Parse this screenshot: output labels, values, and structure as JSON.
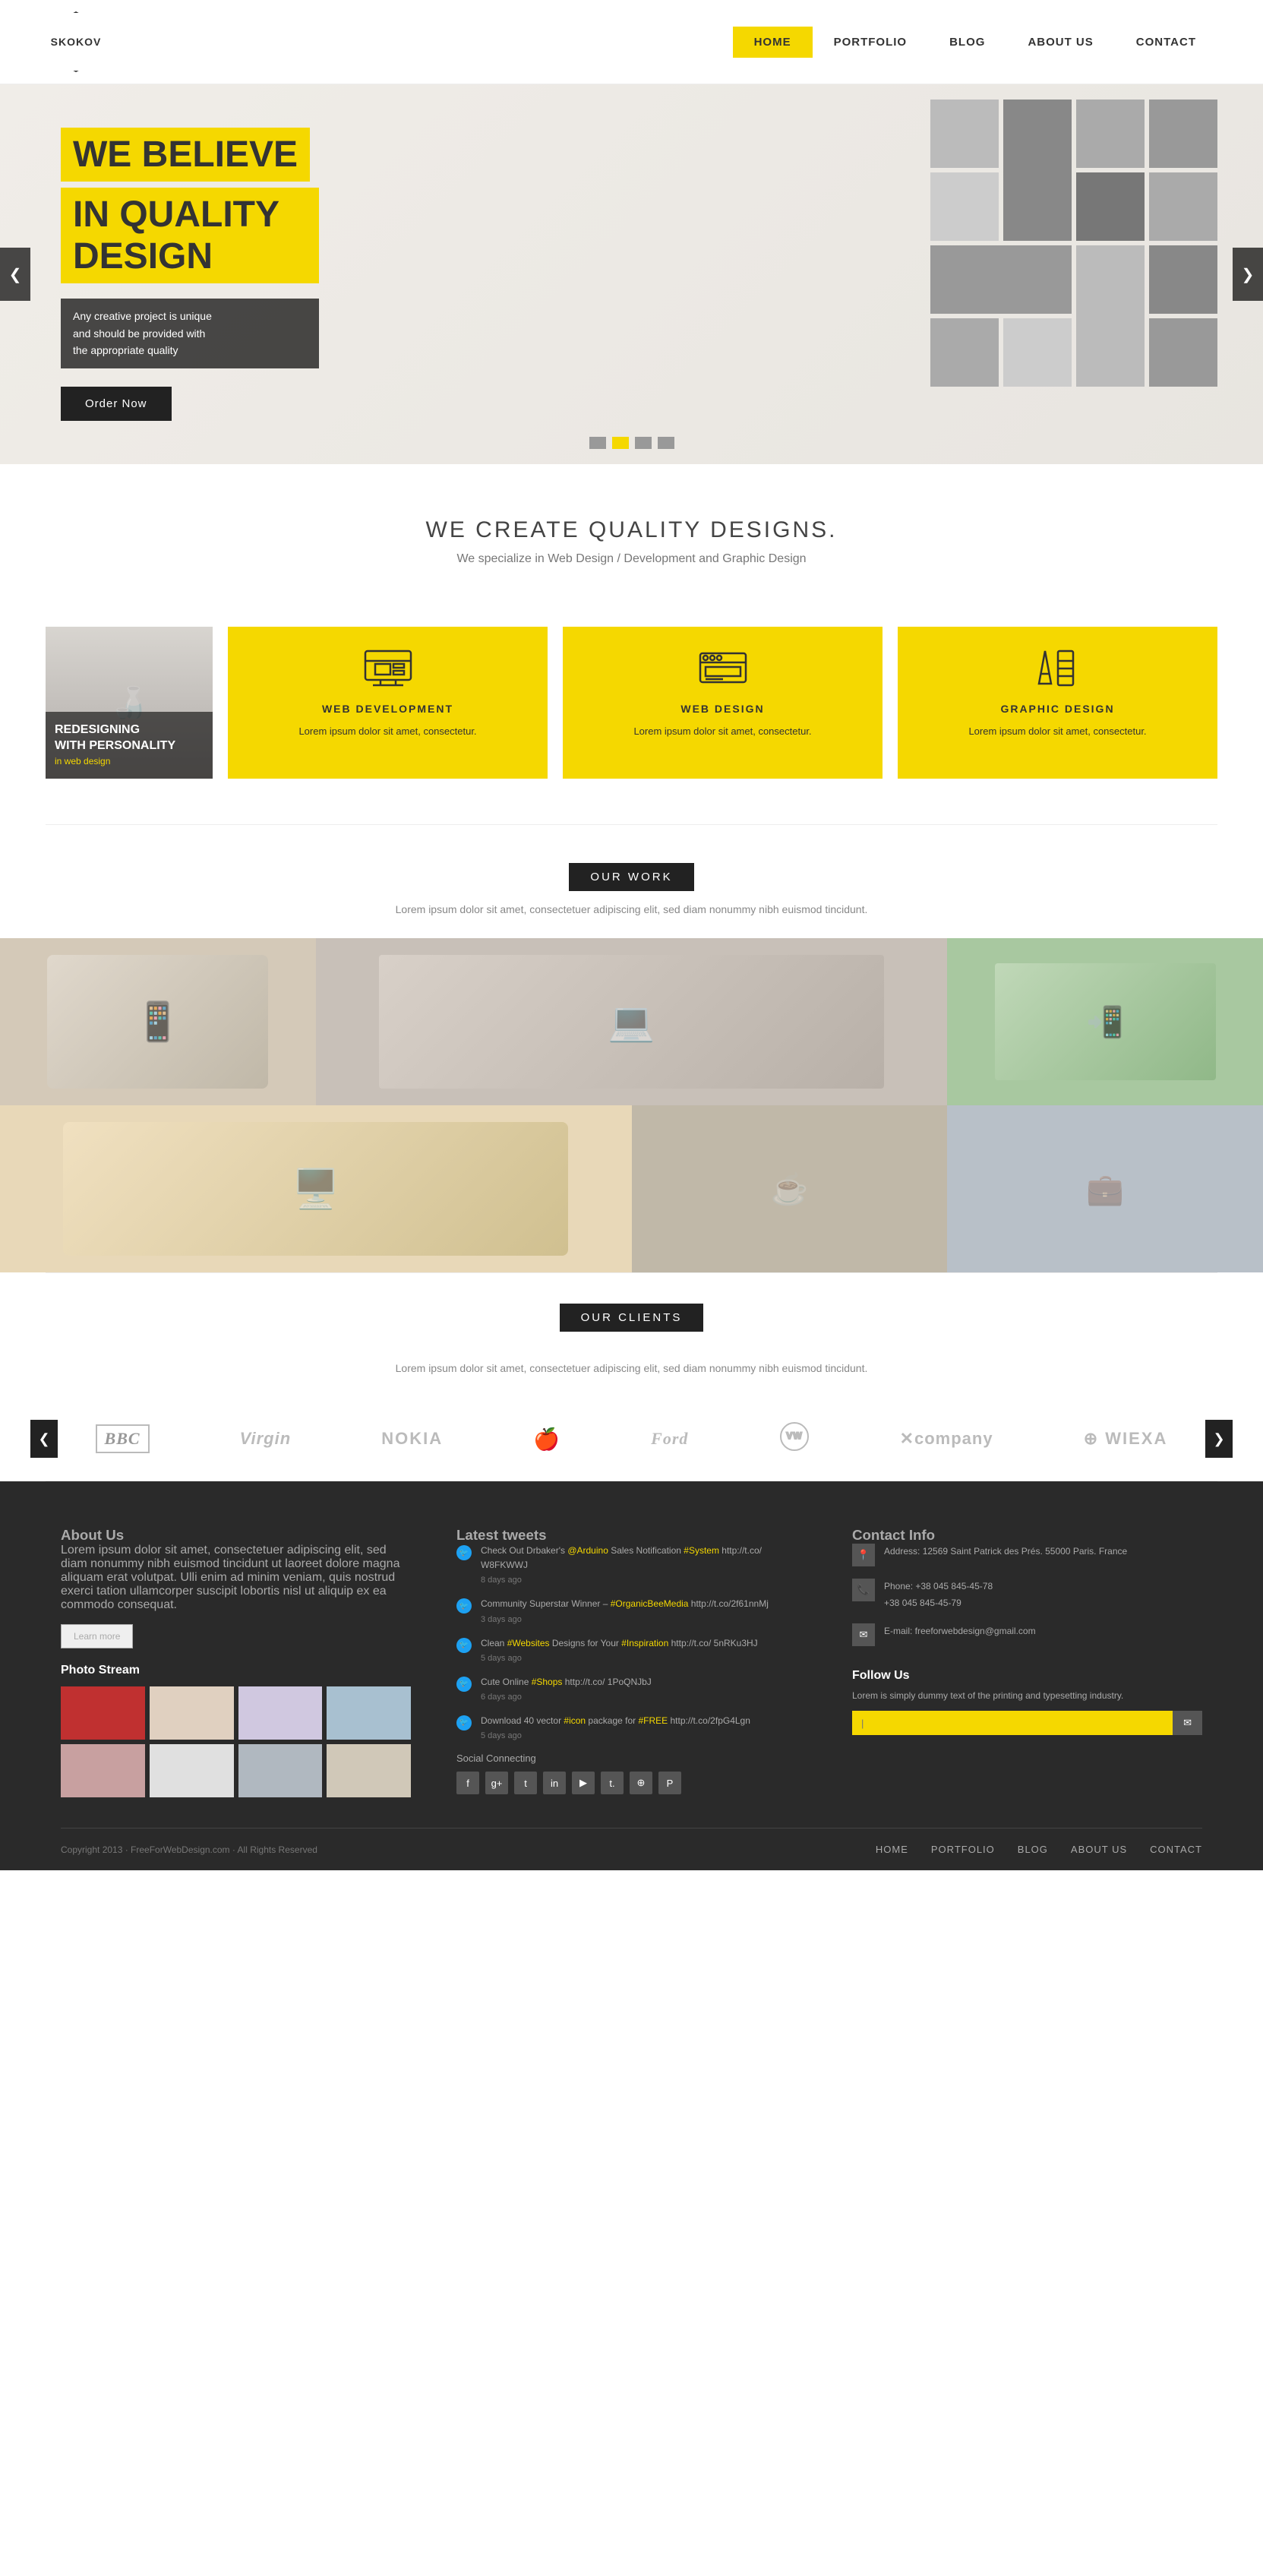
{
  "header": {
    "logo": "SKOKOV",
    "nav": [
      {
        "label": "HOME",
        "active": true
      },
      {
        "label": "PORTFOLIO",
        "active": false
      },
      {
        "label": "BLOG",
        "active": false
      },
      {
        "label": "ABOUT US",
        "active": false
      },
      {
        "label": "CONTACT",
        "active": false
      }
    ]
  },
  "hero": {
    "title_line1": "WE BELIEVE",
    "title_line2": "IN QUALITY DESIGN",
    "subtitle": "Any creative project is unique\nand should be provided with\nthe appropriate quality",
    "cta_button": "Order Now",
    "prev_label": "❮",
    "next_label": "❯",
    "dots": [
      {
        "active": false
      },
      {
        "active": true
      },
      {
        "active": false
      },
      {
        "active": false
      }
    ]
  },
  "we_create": {
    "title": "WE CREATE QUALITY DESIGNS.",
    "subtitle": "We specialize in Web Design / Development and Graphic Design"
  },
  "services": {
    "featured": {
      "title": "REDESIGNING\nWITH PERSONALITY",
      "subtitle": "in web design"
    },
    "cards": [
      {
        "title": "WEB DEVELOPMENT",
        "desc": "Lorem ipsum dolor sit amet, consectetur.",
        "icon": "monitor"
      },
      {
        "title": "WEB DESIGN",
        "desc": "Lorem ipsum dolor sit amet, consectetur.",
        "icon": "browser"
      },
      {
        "title": "GRAPHIC DESIGN",
        "desc": "Lorem ipsum dolor sit amet, consectetur.",
        "icon": "pencil"
      }
    ]
  },
  "our_work": {
    "label": "OUR WORK",
    "desc": "Lorem ipsum dolor sit amet, consectetuer adipiscing elit, sed diam nonummy nibh euismod tincidunt."
  },
  "our_clients": {
    "label": "OUR CLIENTS",
    "desc": "Lorem ipsum dolor sit amet, consectetuer adipiscing elit, sed diam nonummy nibh euismod tincidunt.",
    "logos": [
      "BBC",
      "Virgin",
      "NOKIA",
      "Apple",
      "Ford",
      "VW",
      "Xcompany",
      "WIEXA"
    ],
    "prev": "❮",
    "next": "❯"
  },
  "footer": {
    "about_us": {
      "title": "About Us",
      "text": "Lorem ipsum dolor sit amet, consectetuer adipiscing elit, sed diam nonummy nibh euismod tincidunt ut laoreet dolore magna aliquam erat volutpat. Ulli enim ad minim veniam, quis nostrud exerci tation ullamcorper suscipit lobortis nisl ut aliquip ex ea commodo consequat.",
      "learn_more": "Learn more",
      "photo_stream_title": "Photo Stream"
    },
    "tweets": {
      "title": "Latest tweets",
      "items": [
        {
          "text": "Check Out Drbaker's @Arduino Sales Notification #System http://t.co/ W8FKWWJ",
          "time": "8 days ago"
        },
        {
          "text": "Community Superstar Winner – #OrganicBeeMedia http://t.co/2f61nnMj",
          "time": "3 days ago"
        },
        {
          "text": "Clean #Websites Designs for Your #Inspiration http://t.co/ 5nRKu3HJ",
          "time": "5 days ago"
        },
        {
          "text": "Cute Online #Shops http://t.co/ 1PoQNJbJ",
          "time": "6 days ago"
        },
        {
          "text": "Download 40 vector #icon package for #FREE http://t.co/2fpG4Lgn",
          "time": "5 days ago"
        }
      ],
      "social_title": "Social Connecting"
    },
    "contact": {
      "title": "Contact Info",
      "address": "Address: 12569 Saint Patrick des Prés. 55000 Paris. France",
      "phone": "Phone: +38 045 845-45-78\n+38 045 845-45-79",
      "email": "E-mail: freeforwebdesign@gmail.com",
      "follow_title": "Follow Us",
      "follow_desc": "Lorem is simply dummy text of the printing and typesetting industry.",
      "follow_placeholder": "|",
      "follow_btn": "✉"
    },
    "bottom": {
      "copyright": "Copyright 2013 · FreeForWebDesign.com · All Rights Reserved",
      "nav": [
        "HOME",
        "PORTFOLIO",
        "BLOG",
        "ABOUT US",
        "CONTACT"
      ]
    }
  }
}
